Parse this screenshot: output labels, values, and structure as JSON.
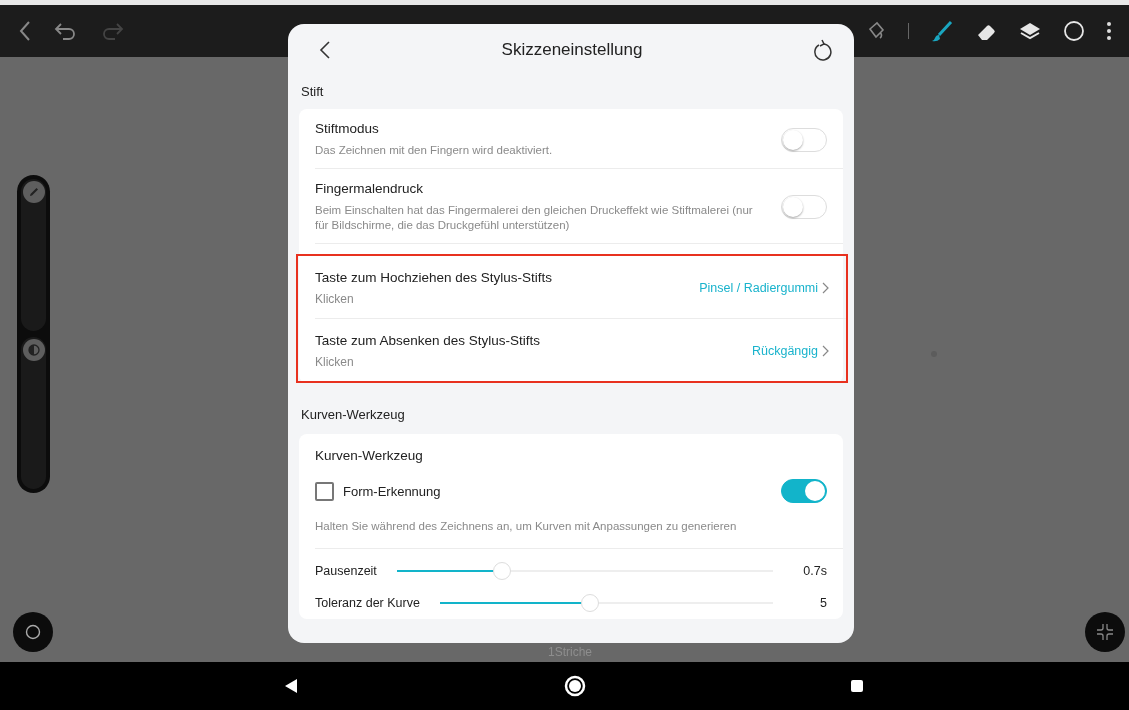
{
  "toolbar": {
    "tools": [
      {
        "kind": "brush",
        "selected": true
      },
      {
        "kind": "eraser",
        "selected": false
      },
      {
        "kind": "layers",
        "selected": false
      },
      {
        "kind": "color",
        "selected": false
      }
    ]
  },
  "canvas": {
    "caption": "1Striche"
  },
  "dialog": {
    "title": "Skizzeneinstellung",
    "sections": [
      {
        "label": "Stift",
        "groups": [
          {
            "highlighted": false,
            "rows": [
              {
                "kind": "toggle",
                "title": "Stiftmodus",
                "description": "Das Zeichnen mit den Fingern wird deaktiviert.",
                "on": false
              },
              {
                "kind": "toggle",
                "title": "Fingermalendruck",
                "description": "Beim Einschalten hat das Fingermalerei den gleichen Druckeffekt wie Stiftmalerei (nur für Bildschirme, die das Druckgefühl unterstützen)",
                "on": false
              }
            ]
          },
          {
            "highlighted": true,
            "rows": [
              {
                "kind": "link",
                "title": "Taste zum Hochziehen des Stylus-Stifts",
                "subtitle": "Klicken",
                "value": "Pinsel / Radiergummi"
              },
              {
                "kind": "link",
                "title": "Taste zum Absenken des Stylus-Stifts",
                "subtitle": "Klicken",
                "value": "Rückgängig"
              }
            ]
          }
        ]
      },
      {
        "label": "Kurven-Werkzeug",
        "groups": [
          {
            "highlighted": false,
            "rows": [
              {
                "kind": "tool",
                "title": "Kurven-Werkzeug",
                "checkbox_label": "Form-Erkennung",
                "checked": false,
                "on": true,
                "description": "Halten Sie während des Zeichnens an, um Kurven mit Anpassungen zu generieren"
              },
              {
                "kind": "slider",
                "label": "Pausenzeit",
                "level": 0.28,
                "reading": "0.7s"
              },
              {
                "kind": "slider",
                "label": "Toleranz der Kurve",
                "level": 0.45,
                "reading": "5"
              }
            ]
          }
        ]
      }
    ]
  }
}
